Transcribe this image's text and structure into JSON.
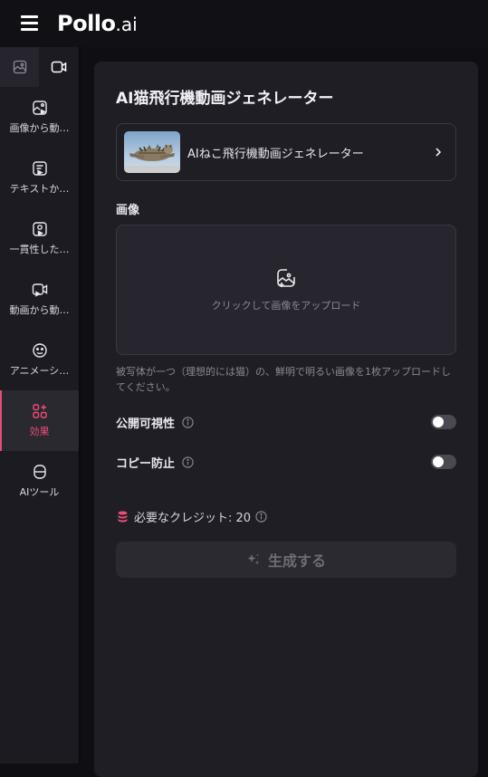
{
  "header": {
    "logo_main": "Pollo",
    "logo_sub": ".ai"
  },
  "sidebar": {
    "items": [
      {
        "label": "画像から動…",
        "icon": "image-to-video-icon",
        "active": false
      },
      {
        "label": "テキストか…",
        "icon": "text-to-video-icon",
        "active": false
      },
      {
        "label": "一貫性した…",
        "icon": "consistent-character-icon",
        "active": false
      },
      {
        "label": "動画から動…",
        "icon": "video-to-video-icon",
        "active": false
      },
      {
        "label": "アニメーシ…",
        "icon": "animation-icon",
        "active": false
      },
      {
        "label": "効果",
        "icon": "effects-icon",
        "active": true
      },
      {
        "label": "AIツール",
        "icon": "ai-tools-icon",
        "active": false
      }
    ]
  },
  "panel": {
    "title": "AI猫飛行機動画ジェネレーター",
    "model_name": "AIねこ飛行機動画ジェネレーター",
    "image_label": "画像",
    "upload_text": "クリックして画像をアップロード",
    "hint": "被写体が一つ（理想的には猫）の、鮮明で明るい画像を1枚アップロードしてください。",
    "public_label": "公開可視性",
    "copy_label": "コピー防止",
    "credits_text": "必要なクレジット: 20",
    "generate_label": "生成する"
  },
  "colors": {
    "accent": "#e94e77",
    "background": "#0f0e13",
    "panel": "#1f1e25"
  }
}
